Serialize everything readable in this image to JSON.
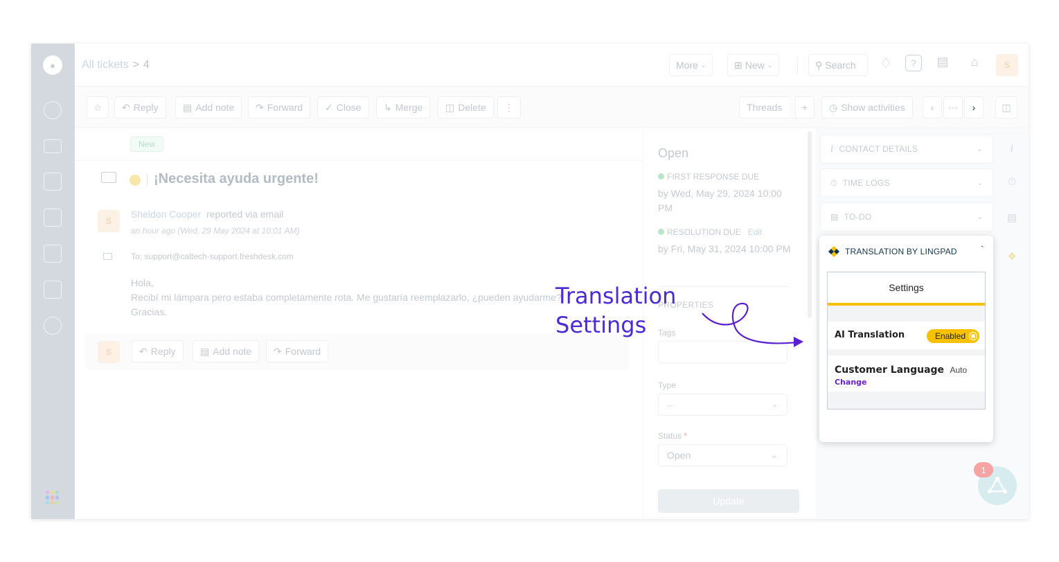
{
  "breadcrumb": {
    "all_tickets": "All tickets",
    "separator": ">",
    "ticket_number": "4"
  },
  "header": {
    "more_label": "More",
    "new_label": "New",
    "search_placeholder": "Search",
    "avatar_initial": "S"
  },
  "toolbar": {
    "reply": "Reply",
    "add_note": "Add note",
    "forward": "Forward",
    "close": "Close",
    "merge": "Merge",
    "delete": "Delete",
    "threads": "Threads",
    "show_activities": "Show activities"
  },
  "ticket": {
    "status_badge": "New",
    "subject": "¡Necesita ayuda urgente!",
    "requester": "Sheldon Cooper",
    "reported_via": "reported via email",
    "time": "an hour ago (Wed, 29 May 2024 at 10:01 AM)",
    "to": "To: support@caltech-support.freshdesk.com",
    "body_line1": "Hola,",
    "body_line2": "Recibí mi lámpara pero estaba completamente rota. Me gustaría reemplazarlo, ¿pueden ayudarme?",
    "body_line3": "Gracias.",
    "avatar_initial": "S",
    "reply": "Reply",
    "add_note": "Add note",
    "forward": "Forward"
  },
  "properties": {
    "status": "Open",
    "first_response_label": "FIRST RESPONSE DUE",
    "first_response_value": "by Wed, May 29, 2024 10:00 PM",
    "resolution_label": "RESOLUTION DUE",
    "resolution_edit": "Edit",
    "resolution_value": "by Fri, May 31, 2024 10:00 PM",
    "section_title": "PROPERTIES",
    "tags_label": "Tags",
    "type_label": "Type",
    "type_value": "--",
    "status_label": "Status",
    "required_mark": "*",
    "status_value": "Open",
    "update_button": "Update"
  },
  "right_panel": {
    "contact_details": "CONTACT DETAILS",
    "time_logs": "TIME LOGS",
    "todo": "TO-DO",
    "translation_title": "TRANSLATION BY LINGPAD",
    "settings_tab": "Settings",
    "ai_translation_label": "AI Translation",
    "ai_translation_state": "Enabled",
    "customer_language_label": "Customer Language",
    "customer_language_value": "Auto",
    "change_link": "Change"
  },
  "annotation": {
    "line1": "Translation",
    "line2": "Settings"
  },
  "bot": {
    "badge_count": "1"
  },
  "colors": {
    "accent_purple": "#4b2ad6",
    "toggle_yellow": "#f7c100",
    "sidebar": "#d3d9de",
    "link_purple": "#6a1ed1"
  }
}
